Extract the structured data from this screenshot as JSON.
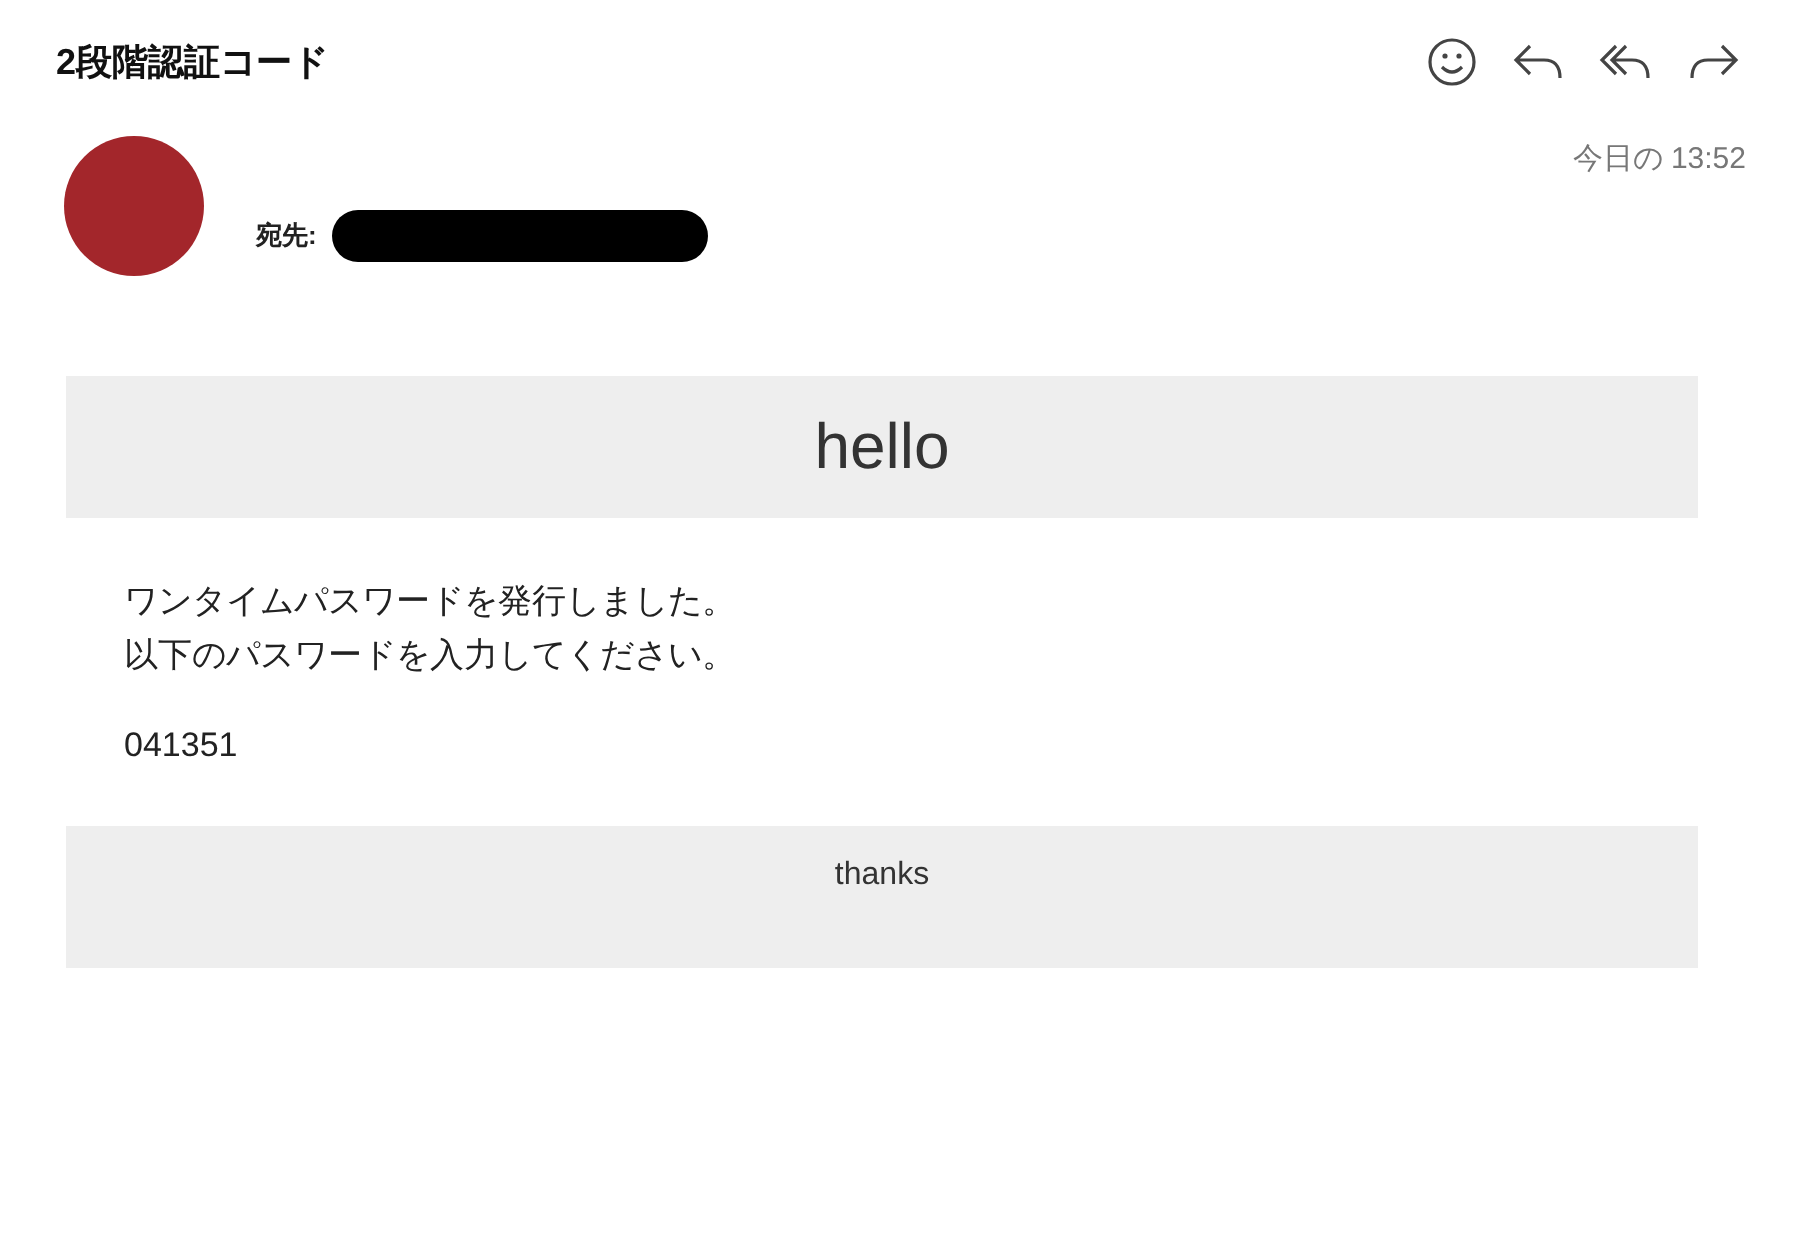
{
  "subject": "2段階認証コード",
  "header": {
    "date": "今日の 13:52",
    "to_label": "宛先:"
  },
  "body": {
    "heading": "hello",
    "lines": [
      "ワンタイムパスワードを発行しました。",
      "以下のパスワードを入力してください。"
    ],
    "code": "041351",
    "footer": "thanks"
  }
}
